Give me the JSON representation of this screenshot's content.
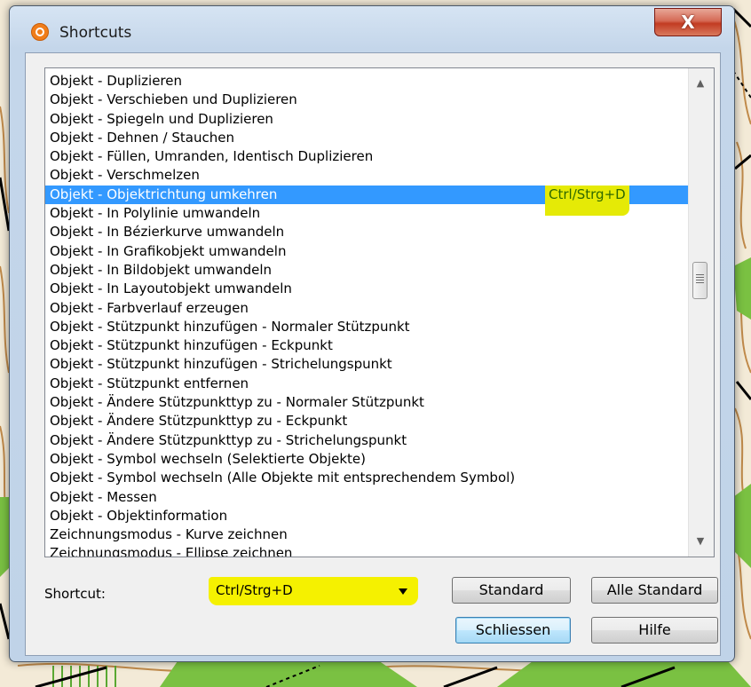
{
  "window": {
    "title": "Shortcuts",
    "close_glyph": "X",
    "icon": "app-o-icon"
  },
  "list": {
    "items": [
      {
        "label": "Objekt - Duplizieren",
        "shortcut": ""
      },
      {
        "label": "Objekt - Verschieben und Duplizieren",
        "shortcut": ""
      },
      {
        "label": "Objekt - Spiegeln und Duplizieren",
        "shortcut": ""
      },
      {
        "label": "Objekt - Dehnen / Stauchen",
        "shortcut": ""
      },
      {
        "label": "Objekt - Füllen, Umranden, Identisch Duplizieren",
        "shortcut": ""
      },
      {
        "label": "Objekt - Verschmelzen",
        "shortcut": ""
      },
      {
        "label": "Objekt - Objektrichtung umkehren",
        "shortcut": "Ctrl/Strg+D",
        "selected": true
      },
      {
        "label": "Objekt - In Polylinie umwandeln",
        "shortcut": ""
      },
      {
        "label": "Objekt - In Bézierkurve umwandeln",
        "shortcut": ""
      },
      {
        "label": "Objekt - In Grafikobjekt umwandeln",
        "shortcut": ""
      },
      {
        "label": "Objekt - In Bildobjekt umwandeln",
        "shortcut": ""
      },
      {
        "label": "Objekt - In Layoutobjekt umwandeln",
        "shortcut": ""
      },
      {
        "label": "Objekt - Farbverlauf erzeugen",
        "shortcut": ""
      },
      {
        "label": "Objekt - Stützpunkt hinzufügen - Normaler Stützpunkt",
        "shortcut": ""
      },
      {
        "label": "Objekt - Stützpunkt hinzufügen - Eckpunkt",
        "shortcut": ""
      },
      {
        "label": "Objekt - Stützpunkt hinzufügen - Strichelungspunkt",
        "shortcut": ""
      },
      {
        "label": "Objekt - Stützpunkt entfernen",
        "shortcut": ""
      },
      {
        "label": "Objekt - Ändere Stützpunkttyp zu - Normaler Stützpunkt",
        "shortcut": ""
      },
      {
        "label": "Objekt - Ändere Stützpunkttyp zu - Eckpunkt",
        "shortcut": ""
      },
      {
        "label": "Objekt - Ändere Stützpunkttyp zu - Strichelungspunkt",
        "shortcut": ""
      },
      {
        "label": "Objekt - Symbol wechseln (Selektierte Objekte)",
        "shortcut": ""
      },
      {
        "label": "Objekt - Symbol wechseln (Alle Objekte mit entsprechendem Symbol)",
        "shortcut": ""
      },
      {
        "label": "Objekt - Messen",
        "shortcut": ""
      },
      {
        "label": "Objekt - Objektinformation",
        "shortcut": ""
      },
      {
        "label": "Zeichnungsmodus - Kurve zeichnen",
        "shortcut": ""
      },
      {
        "label": "Zeichnungsmodus - Ellipse zeichnen",
        "shortcut": ""
      }
    ],
    "scroll_position_fraction": 0.42
  },
  "shortcut": {
    "label": "Shortcut:",
    "value": "Ctrl/Strg+D"
  },
  "buttons": {
    "standard": "Standard",
    "alle_standard": "Alle Standard",
    "schliessen": "Schliessen",
    "hilfe": "Hilfe"
  },
  "colors": {
    "selection": "#3399ff",
    "highlight": "#f5f200"
  }
}
